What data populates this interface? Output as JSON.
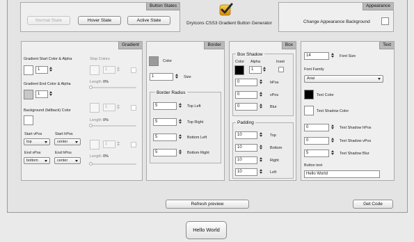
{
  "app": {
    "title": "DryIcons CSS3 Gradient Button Generator"
  },
  "button_states": {
    "title": "Button States",
    "normal": "Normal State",
    "hover": "Hover State",
    "active": "Active State"
  },
  "appearance": {
    "title": "Appearance",
    "change_bg": "Change Appearance Background"
  },
  "gradient": {
    "title": "Gradient",
    "start_label": "Gradient Start Color & Alpha",
    "start_alpha": "1",
    "end_label": "Gradient End Color & Alpha",
    "end_alpha": "1",
    "bg_label": "Background (fallback) Color",
    "start_vpos_label": "Start vPos",
    "start_vpos": "top",
    "start_hpos_label": "Start hPos",
    "start_hpos": "center",
    "end_vpos_label": "End vPos",
    "end_vpos": "bottom",
    "end_hpos_label": "End hPos",
    "end_hpos": "center",
    "stop_colors_label": "Stop Colors",
    "stops": [
      {
        "alpha": "1",
        "length_label": "Length",
        "length_value": "0%"
      },
      {
        "alpha": "1",
        "length_label": "Length",
        "length_value": "0%"
      },
      {
        "alpha": "1",
        "length_label": "Length",
        "length_value": "0%"
      }
    ]
  },
  "border": {
    "title": "Border",
    "color_label": "Color",
    "size_value": "1",
    "size_label": "Size",
    "radius_title": "Border Radius",
    "radius": [
      {
        "value": "5",
        "label": "Top Left"
      },
      {
        "value": "5",
        "label": "Top Right"
      },
      {
        "value": "5",
        "label": "Bottom Left"
      },
      {
        "value": "5",
        "label": "Bottom Right"
      }
    ]
  },
  "box": {
    "title": "Box",
    "shadow_title": "Box Shadow",
    "color_label": "Color",
    "alpha_label": "Alpha",
    "inset_label": "Inset",
    "alpha_value": "1",
    "shadow_fields": [
      {
        "value": "0",
        "label": "hPos"
      },
      {
        "value": "0",
        "label": "vPos"
      },
      {
        "value": "0",
        "label": "Blur"
      }
    ],
    "padding_title": "Padding",
    "padding_fields": [
      {
        "value": "10",
        "label": "Top"
      },
      {
        "value": "10",
        "label": "Bottom"
      },
      {
        "value": "10",
        "label": "Right"
      },
      {
        "value": "10",
        "label": "Left"
      }
    ]
  },
  "text": {
    "title": "Text",
    "font_size_value": "14",
    "font_size_label": "Font Size",
    "font_family_label": "Font Family",
    "font_family_value": "Arial",
    "text_color_label": "Text Color",
    "shadow_color_label": "Text  Shadow Color",
    "shadow_fields": [
      {
        "value": "0",
        "label": "Text Shadow hPos"
      },
      {
        "value": "0",
        "label": "Text Shadow vPos"
      },
      {
        "value": "5",
        "label": "Text Shadow Blur"
      }
    ],
    "button_text_label": "Button text",
    "button_text_value": "Hello World"
  },
  "actions": {
    "refresh": "Refresh preview",
    "get_code": "Get Code"
  },
  "preview": {
    "label": "Hello World"
  }
}
